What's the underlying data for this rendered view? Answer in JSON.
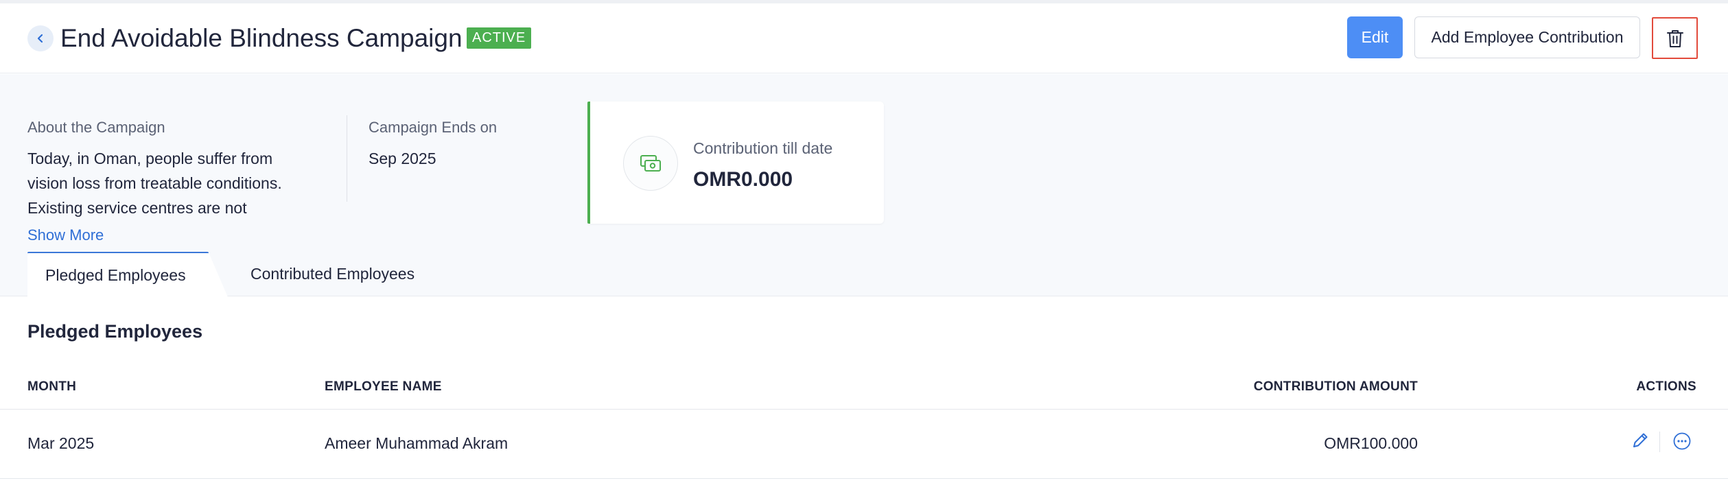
{
  "header": {
    "title": "End Avoidable Blindness Campaign",
    "status_badge": "ACTIVE",
    "edit_label": "Edit",
    "add_contribution_label": "Add Employee Contribution",
    "back_icon": "chevron-left-icon",
    "delete_icon": "trash-icon"
  },
  "summary": {
    "about_label": "About the Campaign",
    "about_text": "Today, in Oman, people suffer from vision loss from treatable conditions. Existing service centres are not",
    "show_more_label": "Show More",
    "ends_label": "Campaign Ends on",
    "ends_value": "Sep 2025",
    "contribution_label": "Contribution till date",
    "contribution_value": "OMR0.000",
    "contribution_icon": "money-icon"
  },
  "tabs": [
    {
      "label": "Pledged Employees",
      "active": true
    },
    {
      "label": "Contributed Employees",
      "active": false
    }
  ],
  "section": {
    "title": "Pledged Employees",
    "columns": [
      "MONTH",
      "EMPLOYEE NAME",
      "CONTRIBUTION AMOUNT",
      "ACTIONS"
    ],
    "rows": [
      {
        "month": "Mar 2025",
        "employee_name": "Ameer Muhammad Akram",
        "amount": "OMR100.000"
      }
    ]
  },
  "colors": {
    "primary": "#4d8ef5",
    "active_badge": "#4caf50",
    "delete_border": "#e24a3b",
    "link": "#2f6fd6"
  }
}
